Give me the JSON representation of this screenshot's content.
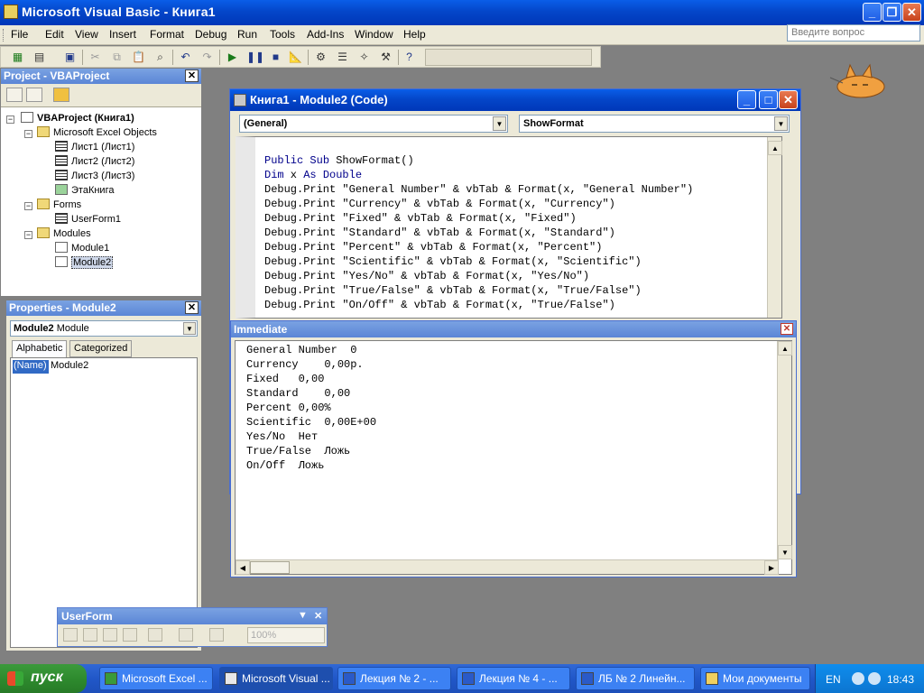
{
  "window": {
    "title": "Microsoft Visual Basic - Книга1"
  },
  "menu": [
    "File",
    "Edit",
    "View",
    "Insert",
    "Format",
    "Debug",
    "Run",
    "Tools",
    "Add-Ins",
    "Window",
    "Help"
  ],
  "help_search": {
    "placeholder": "Введите вопрос"
  },
  "project": {
    "title": "Project - VBAProject",
    "tree": {
      "root": "VBAProject (Книга1)",
      "excel_objects": "Microsoft Excel Objects",
      "sheet1": "Лист1 (Лист1)",
      "sheet2": "Лист2 (Лист2)",
      "sheet3": "Лист3 (Лист3)",
      "thisworkbook": "ЭтаКнига",
      "forms": "Forms",
      "userform1": "UserForm1",
      "modules": "Modules",
      "module1": "Module1",
      "module2": "Module2"
    }
  },
  "properties": {
    "title": "Properties - Module2",
    "object_name": "Module2",
    "object_type": "Module",
    "tab_alphabetic": "Alphabetic",
    "tab_categorized": "Categorized",
    "row_name": "(Name)",
    "row_value": "Module2"
  },
  "userform_toolbar": {
    "title": "UserForm",
    "zoom": "100%"
  },
  "code_window": {
    "title": "Книга1 - Module2 (Code)",
    "object_combo": "(General)",
    "proc_combo": "ShowFormat",
    "lines": [
      "Public Sub ShowFormat()",
      "Dim x As Double",
      "Debug.Print \"General Number\" & vbTab & Format(x, \"General Number\")",
      "Debug.Print \"Currency\" & vbTab & Format(x, \"Currency\")",
      "Debug.Print \"Fixed\" & vbTab & Format(x, \"Fixed\")",
      "Debug.Print \"Standard\" & vbTab & Format(x, \"Standard\")",
      "Debug.Print \"Percent\" & vbTab & Format(x, \"Percent\")",
      "Debug.Print \"Scientific\" & vbTab & Format(x, \"Scientific\")",
      "Debug.Print \"Yes/No\" & vbTab & Format(x, \"Yes/No\")",
      "Debug.Print \"True/False\" & vbTab & Format(x, \"True/False\")",
      "Debug.Print \"On/Off\" & vbTab & Format(x, \"True/False\")"
    ]
  },
  "immediate": {
    "title": "Immediate",
    "lines": [
      "General Number  0",
      "Currency    0,00р.",
      "Fixed   0,00",
      "Standard    0,00",
      "Percent 0,00%",
      "Scientific  0,00E+00",
      "Yes/No  Нет",
      "True/False  Ложь",
      "On/Off  Ложь"
    ]
  },
  "taskbar": {
    "start": "пуск",
    "tasks": [
      "Microsoft Excel ...",
      "Microsoft Visual ...",
      "Лекция № 2 - ...",
      "Лекция № 4 - ...",
      "ЛБ № 2 Линейн...",
      "Мои документы"
    ],
    "lang": "EN",
    "time": "18:43"
  }
}
